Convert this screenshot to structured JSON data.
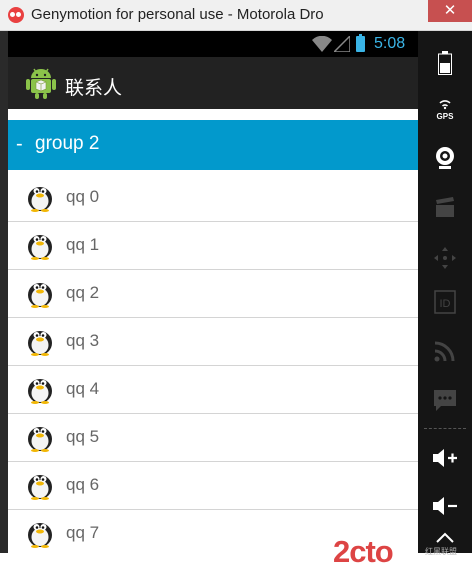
{
  "window": {
    "title": "Genymotion for personal use - Motorola Dro",
    "close_label": "✕"
  },
  "statusbar": {
    "time": "5:08"
  },
  "actionbar": {
    "title": "联系人"
  },
  "group": {
    "indicator": "-",
    "label": "group 2"
  },
  "items": [
    "qq 0",
    "qq 1",
    "qq 2",
    "qq 3",
    "qq 4",
    "qq 5",
    "qq 6",
    "qq 7"
  ],
  "panel": {
    "gps_label": "GPS",
    "id_label": "ID"
  },
  "watermark": {
    "logo": "2cto",
    "sub": "红黑联盟"
  },
  "colors": {
    "accent": "#0299cc",
    "status_text": "#3ab4e6",
    "window_close": "#c75050"
  }
}
